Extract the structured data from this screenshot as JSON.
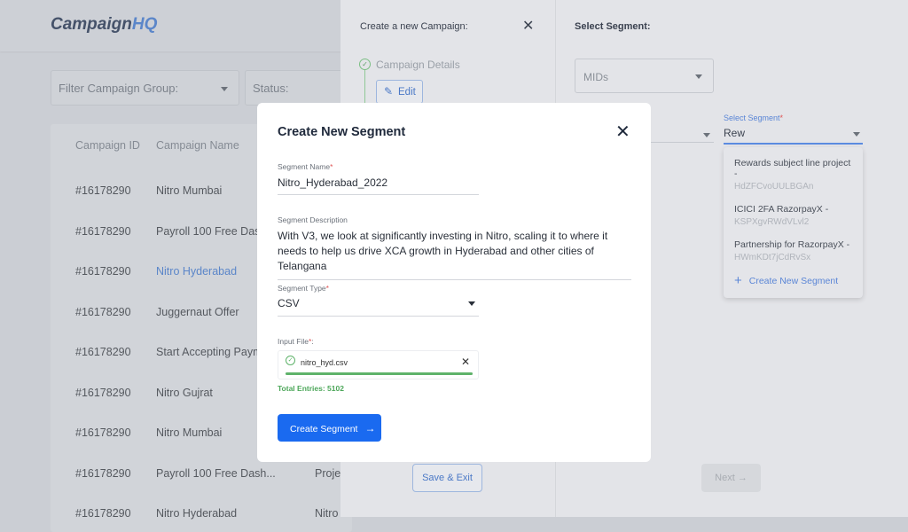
{
  "app": {
    "logo_main": "Campaign",
    "logo_accent": "HQ"
  },
  "filters": {
    "group_placeholder": "Filter Campaign Group:",
    "status_placeholder": "Status:"
  },
  "table": {
    "headers": [
      "Campaign ID",
      "Campaign Name"
    ],
    "rows": [
      {
        "id": "#16178290",
        "name": "Nitro Mumbai",
        "extra": ""
      },
      {
        "id": "#16178290",
        "name": "Payroll 100 Free Dash...",
        "extra": ""
      },
      {
        "id": "#16178290",
        "name": "Nitro Hyderabad",
        "extra": "",
        "highlight": true
      },
      {
        "id": "#16178290",
        "name": "Juggernaut Offer",
        "extra": ""
      },
      {
        "id": "#16178290",
        "name": "Start Accepting Paym...",
        "extra": ""
      },
      {
        "id": "#16178290",
        "name": "Nitro Gujrat",
        "extra": ""
      },
      {
        "id": "#16178290",
        "name": "Nitro Mumbai",
        "extra": ""
      },
      {
        "id": "#16178290",
        "name": "Payroll 100 Free Dash...",
        "extra": "Projec"
      },
      {
        "id": "#16178290",
        "name": "Nitro Hyderabad",
        "extra": "Nitro"
      }
    ]
  },
  "drawer": {
    "title": "Create a new Campaign:",
    "step_label": "Campaign Details",
    "edit_label": "Edit",
    "save_exit_label": "Save & Exit",
    "next_label": "Next",
    "segment_title": "Select Segment:",
    "mids_placeholder": "MIDs",
    "select_segment": {
      "label": "Select Segment",
      "value": "Rew",
      "options": [
        {
          "title": "Rewards subject line project -",
          "id": "HdZFCvoUULBGAn"
        },
        {
          "title": "ICICI 2FA RazorpayX -",
          "id": "KSPXgvRWdVLvl2"
        },
        {
          "title": "Partnership for RazorpayX -",
          "id": "HWmKDt7jCdRvSx"
        }
      ],
      "create_label": "Create New Segment"
    }
  },
  "modal": {
    "title": "Create New Segment",
    "name_label": "Segment Name",
    "name_value": "Nitro_Hyderabad_2022",
    "desc_label": "Segment Description",
    "desc_value": "With V3, we look at significantly investing in Nitro, scaling it to where it needs to help us drive XCA growth in Hyderabad and other cities of Telangana",
    "type_label": "Segment Type",
    "type_value": "CSV",
    "file_label": "Input File",
    "file_name": "nitro_hyd.csv",
    "upload_progress_percent": 100,
    "total_entries": "Total Entries: 5102",
    "submit_label": "Create Segment"
  },
  "colors": {
    "primary": "#1a6af0",
    "success": "#5fb36a",
    "link": "#5b86d6"
  }
}
